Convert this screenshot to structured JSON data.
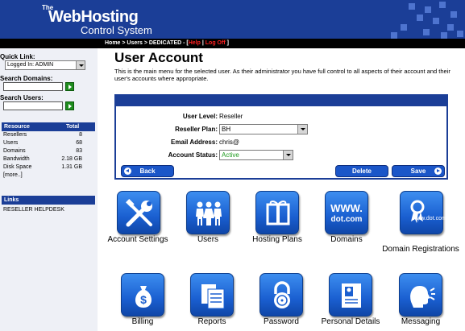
{
  "header": {
    "logo_the": "The",
    "logo_name": "WebHosting",
    "logo_sub": "Control System",
    "breadcrumb": "Home > Users > DEDICATED - [",
    "help": "Help",
    "separator": " | ",
    "logoff": "Log Off",
    "close": " ]"
  },
  "sidebar": {
    "quick_links_label": "Quick Link:",
    "quick_links_value": "Logged In: ADMIN",
    "search_domains_label": "Search Domains:",
    "search_users_label": "Search Users:",
    "resource_header": "Resource",
    "total_header": "Total",
    "resources": [
      {
        "name": "Resellers",
        "total": "8"
      },
      {
        "name": "Users",
        "total": "68"
      },
      {
        "name": "Domains",
        "total": "83"
      },
      {
        "name": "Bandwidth",
        "total": "2.18 GB"
      },
      {
        "name": "Disk Space",
        "total": "1.31 GB"
      }
    ],
    "more": "[more..]",
    "links_header": "Links",
    "links": [
      "RESELLER HELPDESK"
    ]
  },
  "main": {
    "title": "User Account",
    "description": "This is the main menu for the selected user. As their administrator you have full control to all aspects of their account and their user's accounts where appropriate.",
    "form": {
      "user_level_label": "User Level:",
      "user_level_value": "Reseller",
      "reseller_plan_label": "Reseller Plan:",
      "reseller_plan_value": "BH",
      "email_label": "Email Address:",
      "email_value": "chris@",
      "status_label": "Account Status:",
      "status_value": "Active"
    },
    "buttons": {
      "back": "Back",
      "delete": "Delete",
      "save": "Save"
    },
    "icons": [
      {
        "label": "Account Settings",
        "icon": "tools-icon"
      },
      {
        "label": "Users",
        "icon": "users-icon"
      },
      {
        "label": "Hosting Plans",
        "icon": "gift-icon"
      },
      {
        "label": "Domains",
        "icon": "www-icon",
        "tile_text_1": "WWW.",
        "tile_text_2": "dot.com"
      },
      {
        "label": "Domain Registrations",
        "icon": "award-icon",
        "tile_text_1": "www.dot.com"
      },
      {
        "label": "Billing",
        "icon": "money-bag-icon"
      },
      {
        "label": "Reports",
        "icon": "reports-icon"
      },
      {
        "label": "Password",
        "icon": "lock-icon"
      },
      {
        "label": "Personal Details",
        "icon": "id-card-icon"
      },
      {
        "label": "Messaging",
        "icon": "speaking-head-icon"
      }
    ]
  },
  "colors": {
    "brand_blue": "#1b3e97",
    "accent_red": "#ff2020",
    "go_green": "#1e8c1e",
    "status_green": "#1e9a1e"
  }
}
